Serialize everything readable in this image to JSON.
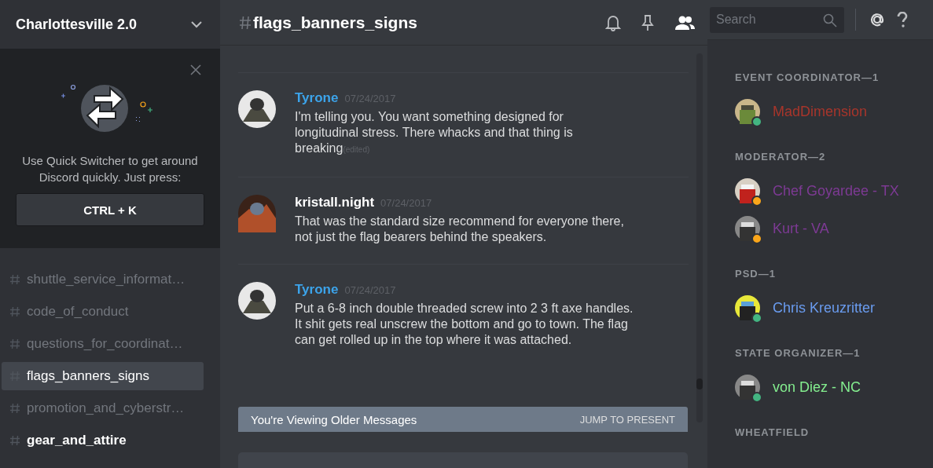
{
  "server": {
    "name": "Charlottesville 2.0"
  },
  "quick_switcher": {
    "text": "Use Quick Switcher to get around Discord quickly. Just press:",
    "shortcut": "CTRL + K"
  },
  "channels": [
    {
      "name": "shuttle_service_informat…",
      "selected": false,
      "unread": false
    },
    {
      "name": "code_of_conduct",
      "selected": false,
      "unread": false
    },
    {
      "name": "questions_for_coordinat…",
      "selected": false,
      "unread": false
    },
    {
      "name": "flags_banners_signs",
      "selected": true,
      "unread": false
    },
    {
      "name": "promotion_and_cyberstr…",
      "selected": false,
      "unread": false
    },
    {
      "name": "gear_and_attire",
      "selected": false,
      "unread": true
    }
  ],
  "channel_header": {
    "name": "flags_banners_signs"
  },
  "search": {
    "placeholder": "Search"
  },
  "messages": [
    {
      "author": "Tyrone",
      "color": "#3ca4eb",
      "timestamp": "07/24/2017",
      "text": "I'm telling you. You want something designed for longitudinal stress. There whacks and that thing is breaking",
      "edited": "(edited)"
    },
    {
      "author": "kristall.night",
      "color": "#ffffff",
      "timestamp": "07/24/2017",
      "text": "That was the standard size recommend for everyone there, not just the flag bearers behind the speakers."
    },
    {
      "author": "Tyrone",
      "color": "#3ca4eb",
      "timestamp": "07/24/2017",
      "text": "Put a 6-8 inch double threaded screw into 2 3 ft axe handles. It shit gets real unscrew the bottom and go to town. The flag can get rolled up in the top where it was attached."
    }
  ],
  "older_banner": {
    "text": "You're Viewing Older Messages",
    "action": "JUMP TO PRESENT"
  },
  "member_groups": [
    {
      "title": "EVENT COORDINATOR—1",
      "members": [
        {
          "name": "MadDimension",
          "color": "#a8352b",
          "status": {
            "color": "#43b581"
          }
        }
      ]
    },
    {
      "title": "MODERATOR—2",
      "members": [
        {
          "name": "Chef Goyardee - TX",
          "color": "#7d3a94",
          "status": {
            "color": "#faa61a"
          }
        },
        {
          "name": "Kurt - VA",
          "color": "#7d3a94",
          "status": {
            "color": "#faa61a"
          }
        }
      ]
    },
    {
      "title": "PSD—1",
      "members": [
        {
          "name": "Chris Kreuzritter",
          "color": "#6a9cf0",
          "status": {
            "color": "#43b581"
          }
        }
      ]
    },
    {
      "title": "STATE ORGANIZER—1",
      "members": [
        {
          "name": "von Diez - NC",
          "color": "#84ee8f",
          "status": {
            "color": "#43b581"
          }
        }
      ]
    },
    {
      "title": "WHEATFIELD"
    }
  ]
}
